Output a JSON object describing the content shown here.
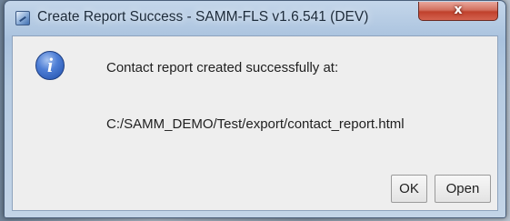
{
  "window": {
    "title": "Create Report Success - SAMM-FLS v1.6.541 (DEV)",
    "close_symbol": "x"
  },
  "dialog": {
    "icon": "info-icon",
    "message": "Contact report created successfully at:",
    "path": "C:/SAMM_DEMO/Test/export/contact_report.html"
  },
  "buttons": {
    "ok_label": "OK",
    "open_label": "Open"
  },
  "colors": {
    "titlebar": "#b6cbe2",
    "content_bg": "#eeeeee",
    "close_button": "#c0412c",
    "info_icon": "#1f4eaa"
  }
}
